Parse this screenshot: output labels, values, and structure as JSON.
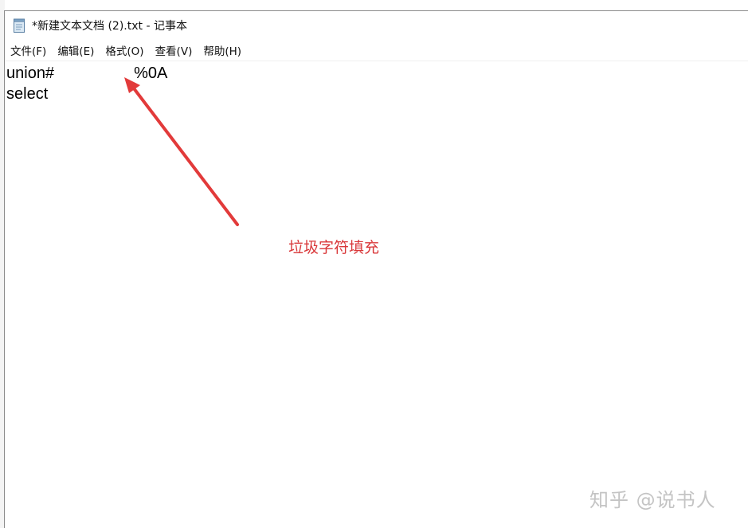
{
  "window": {
    "title": "*新建文本文档 (2).txt - 记事本"
  },
  "menu": {
    "items": [
      {
        "label": "文件(F)"
      },
      {
        "label": "编辑(E)"
      },
      {
        "label": "格式(O)"
      },
      {
        "label": "查看(V)"
      },
      {
        "label": "帮助(H)"
      }
    ]
  },
  "editor": {
    "lines": [
      {
        "text": "union#                  %0A"
      },
      {
        "text": "select"
      }
    ]
  },
  "annotation": {
    "label": "垃圾字符填充",
    "color": "#d9383a"
  },
  "watermark": {
    "text": "知乎 @说书人"
  },
  "icons": {
    "app_icon": "notepad-icon",
    "arrow": "red-arrow-annotation"
  }
}
